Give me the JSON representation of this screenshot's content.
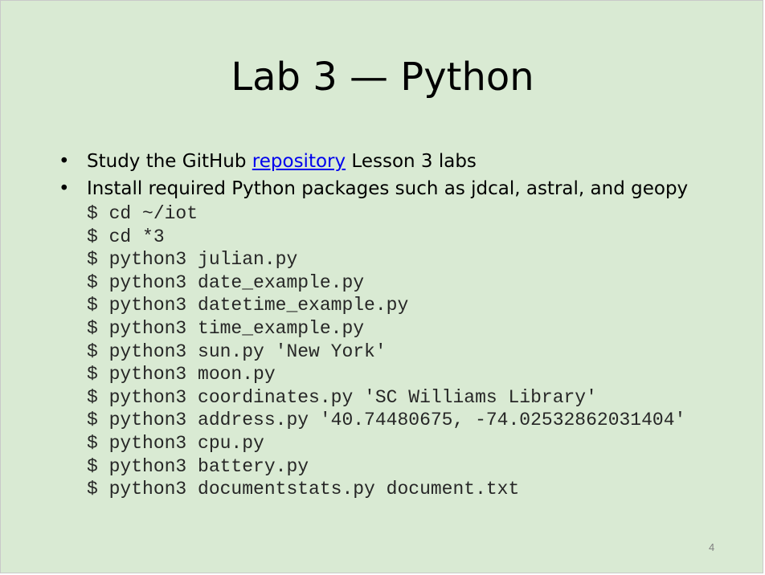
{
  "slide": {
    "title": "Lab 3 — Python",
    "bullet_symbol": "•",
    "bullet1": {
      "before": "Study the GitHub ",
      "link": "repository",
      "after": " Lesson 3 labs"
    },
    "bullet2": "Install required Python packages such as jdcal, astral, and geopy",
    "commands": [
      "$ cd ~/iot",
      "$ cd *3",
      "$ python3 julian.py",
      "$ python3 date_example.py",
      "$ python3 datetime_example.py",
      "$ python3 time_example.py",
      "$ python3 sun.py 'New York'",
      "$ python3 moon.py",
      "$ python3 coordinates.py 'SC Williams Library'",
      "$ python3 address.py '40.74480675, -74.02532862031404'",
      "$ python3 cpu.py",
      "$ python3 battery.py",
      "$ python3 documentstats.py document.txt"
    ],
    "page_number": "4"
  },
  "colors": {
    "background": "#d9ead3",
    "link": "#0000ee",
    "command_text": "#262626"
  }
}
